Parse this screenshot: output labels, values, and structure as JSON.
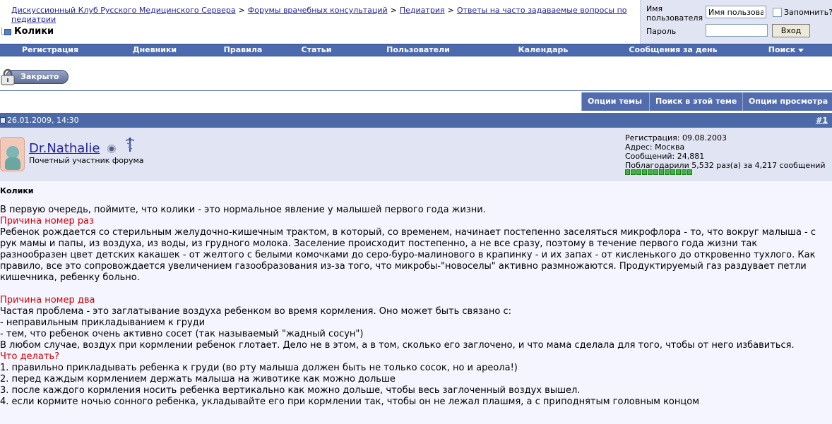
{
  "breadcrumb": {
    "items": [
      "Дискуссионный Клуб Русского Медицинского Сервера",
      "Форумы врачебных консультаций",
      "Педиатрия",
      "Ответы на часто задаваемые вопросы по педиатрии"
    ],
    "separator": ">",
    "current": "Колики"
  },
  "login": {
    "username_label": "Имя пользователя",
    "username_value": "Имя пользоват",
    "remember_label": "Запомнить?",
    "password_label": "Пароль",
    "submit_label": "Вход"
  },
  "navbar": {
    "items": [
      "Регистрация",
      "Дневники",
      "Правила",
      "Статьи",
      "Пользователи",
      "Календарь",
      "Сообщения за день",
      "Поиск"
    ]
  },
  "closed_button": {
    "label": "Закрыто"
  },
  "thread_tools": {
    "items": [
      "Опции темы",
      "Поиск в этой теме",
      "Опции просмотра"
    ]
  },
  "post": {
    "date": "26.01.2009, 14:30",
    "number_prefix": "#",
    "number": "1",
    "username": "Dr.Nathalie",
    "user_title": "Почетный участник форума",
    "info": {
      "registration": "Регистрация: 09.08.2003",
      "address": "Адрес: Москва",
      "messages": "Сообщений: 24,881",
      "thanks": "Поблагодарили 5,532 раз(а) за 4,217 сообщений"
    },
    "reputation_count": 12,
    "title": "Колики",
    "lines": [
      {
        "text": "В первую очередь, поймите, что колики - это нормальное явление у малышей первого года жизни.",
        "red": false
      },
      {
        "text": "Причина номер раз",
        "red": true
      },
      {
        "text": "Ребенок рождается со стерильным желудочно-кишечным трактом, в который, со временем, начинает постепенно заселяться микрофлора - то, что вокруг малыша - с",
        "red": false
      },
      {
        "text": "рук мамы и папы, из воздуха, из воды, из грудного молока. Заселение происходит постепенно, а не все сразу, поэтому в течение первого года жизни так",
        "red": false
      },
      {
        "text": "разнообразен цвет детских какашек - от желтого с белыми комочками до серо-буро-малинового в крапинку - и их запах - от кисленького до откровенно тухлого. Как",
        "red": false
      },
      {
        "text": "правило, все это сопровождается увеличением газообразования из-за того, что микробы-\"новоселы\" активно размножаются. Продуктируемый газ раздувает петли",
        "red": false
      },
      {
        "text": "кишечника, ребенку больно.",
        "red": false
      },
      {
        "text": "",
        "red": false
      },
      {
        "text": "Причина номер два",
        "red": true
      },
      {
        "text": "Частая проблема - это заглатывание воздуха ребенком во время кормления. Оно может быть связано с:",
        "red": false
      },
      {
        "text": "- неправильным прикладыванием к груди",
        "red": false
      },
      {
        "text": "- тем, что ребенок очень активно сосет (так называемый \"жадный сосун\")",
        "red": false
      },
      {
        "text": "В любом случае, воздух при кормлении ребенок глотает. Дело не в этом, а в том, сколько его заглочено, и что мама сделала для того, чтобы от него избавиться.",
        "red": false
      },
      {
        "text": "Что делать?",
        "red": true
      },
      {
        "text": "1. правильно прикладывать ребенка к груди (во рту малыша должен быть не только сосок, но и ареола!)",
        "red": false
      },
      {
        "text": "2. перед каждым кормлением держать малыша на животике как можно дольше",
        "red": false
      },
      {
        "text": "3. после каждого кормления носить ребенка вертикально как можно дольше, чтобы весь заглоченный воздух вышел.",
        "red": false
      },
      {
        "text": "4. если кормите ночью сонного ребенка, укладывайте его при кормлении так, чтобы он не лежал плашмя, а с приподнятым головным концом",
        "red": false
      }
    ]
  }
}
